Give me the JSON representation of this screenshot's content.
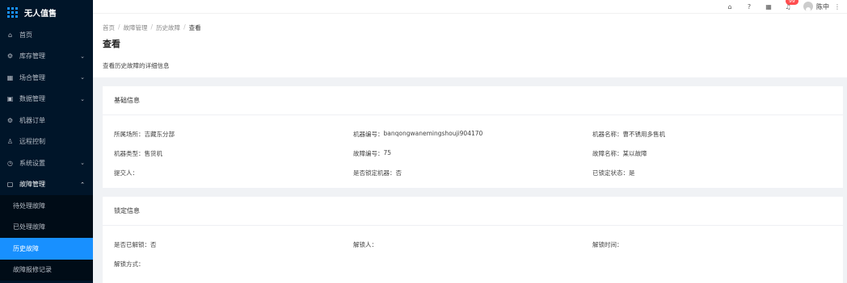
{
  "app": {
    "title": "无人值售"
  },
  "sidebar": {
    "items": [
      {
        "label": "首页",
        "icon": "home-icon",
        "glyph": "⌂",
        "arrow": ""
      },
      {
        "label": "库存管理",
        "icon": "settings-icon",
        "glyph": "⚙",
        "arrow": "⌄"
      },
      {
        "label": "场合管理",
        "icon": "grid-icon",
        "glyph": "▦",
        "arrow": "⌄"
      },
      {
        "label": "数据管理",
        "icon": "file-icon",
        "glyph": "▣",
        "arrow": "⌄"
      },
      {
        "label": "机器订单",
        "icon": "robot-icon",
        "glyph": "⚙",
        "arrow": ""
      },
      {
        "label": "远程控制",
        "icon": "user-icon",
        "glyph": "♙",
        "arrow": ""
      },
      {
        "label": "系统设置",
        "icon": "clock-icon",
        "glyph": "◷",
        "arrow": "⌄"
      },
      {
        "label": "故障管理",
        "icon": "document-icon",
        "glyph": "▢",
        "arrow": "⌃"
      }
    ],
    "subitems": [
      {
        "label": "待处理故障"
      },
      {
        "label": "已处理故障"
      },
      {
        "label": "历史故障"
      },
      {
        "label": "故障报修记录"
      }
    ]
  },
  "header": {
    "badge": "99",
    "username": "陈中"
  },
  "breadcrumb": {
    "items": [
      "首页",
      "故障管理",
      "历史故障"
    ],
    "current": "查看"
  },
  "page": {
    "title": "查看",
    "description": "查看历史故障的详细信息"
  },
  "basic": {
    "title": "基础信息",
    "rows": [
      [
        {
          "label": "所属场所：",
          "value": "吉藏东分部"
        },
        {
          "label": "机器编号：",
          "value": "banqongwanemingshouji904170"
        },
        {
          "label": "机器名称：",
          "value": "曹不锈用多售机"
        }
      ],
      [
        {
          "label": "机器类型：",
          "value": "售货机"
        },
        {
          "label": "故障编号：",
          "value": "75"
        },
        {
          "label": "故障名称：",
          "value": "某以故障"
        }
      ],
      [
        {
          "label": "提交人：",
          "value": ""
        },
        {
          "label": "是否锁定机器：",
          "value": "否"
        },
        {
          "label": "已锁定状态：",
          "value": "是"
        }
      ]
    ]
  },
  "lock": {
    "title": "锁定信息",
    "rows": [
      [
        {
          "label": "是否已解锁：",
          "value": "否"
        },
        {
          "label": "解锁人：",
          "value": ""
        },
        {
          "label": "解锁时间：",
          "value": ""
        }
      ],
      [
        {
          "label": "解锁方式：",
          "value": ""
        }
      ]
    ]
  }
}
